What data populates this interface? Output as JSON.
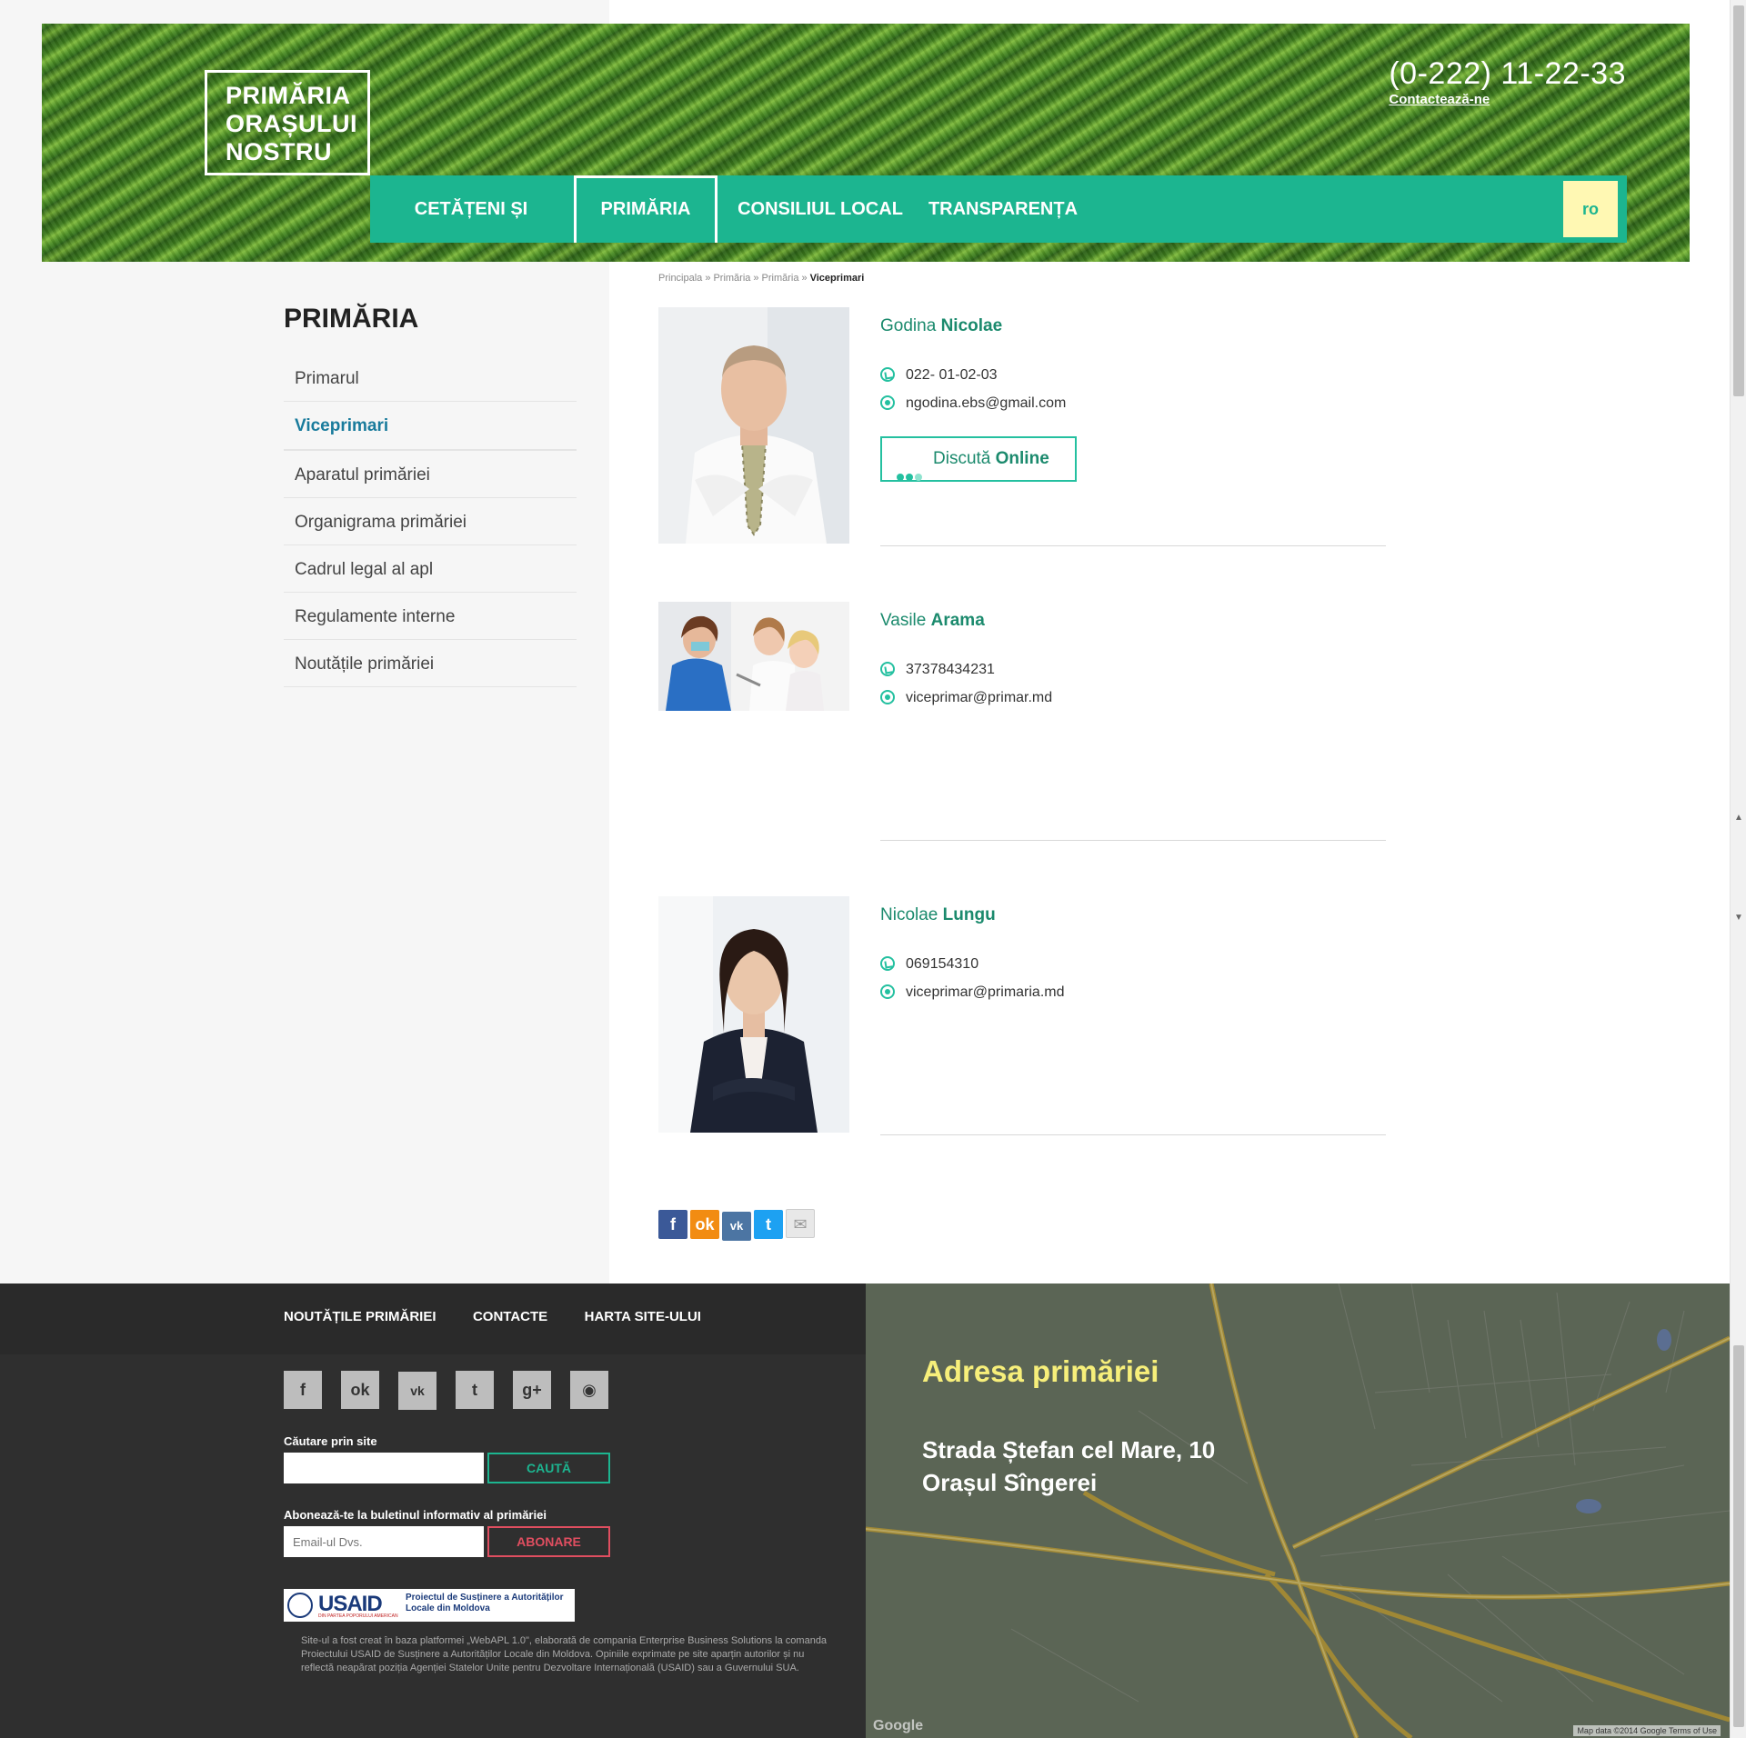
{
  "header": {
    "logo_line1": "PRIMĂRIA",
    "logo_line2": "ORAȘULUI",
    "logo_line3": "NOSTRU",
    "phone": "(0-222) 11-22-33",
    "contact_link": "Contactează-ne"
  },
  "nav": {
    "items": [
      {
        "label": "CETĂȚENI ȘI BUSINESS"
      },
      {
        "label": "PRIMĂRIA"
      },
      {
        "label": "CONSILIUL LOCAL"
      },
      {
        "label": "TRANSPARENȚA"
      }
    ],
    "active": "PRIMĂRIA",
    "lang": "ro"
  },
  "breadcrumb": {
    "items": [
      "Principala",
      "Primăria",
      "Primăria"
    ],
    "separator": "»",
    "current": "Viceprimari"
  },
  "sidebar": {
    "title": "PRIMĂRIA",
    "items": [
      {
        "label": "Primarul"
      },
      {
        "label": "Viceprimari"
      },
      {
        "label": "Aparatul primăriei"
      },
      {
        "label": "Organigrama primăriei"
      },
      {
        "label": "Cadrul legal al apl"
      },
      {
        "label": "Regulamente interne"
      },
      {
        "label": "Noutățile primăriei"
      }
    ],
    "active": "Viceprimari"
  },
  "people": [
    {
      "first": "Godina",
      "last": "Nicolae",
      "phone": "022- 01-02-03",
      "email": "ngodina.ebs@gmail.com",
      "chat_label_1": "Discută",
      "chat_label_2": "Online"
    },
    {
      "first": "Vasile",
      "last": "Arama",
      "phone": "37378434231",
      "email": "viceprimar@primar.md"
    },
    {
      "first": "Nicolae",
      "last": "Lungu",
      "phone": "069154310",
      "email": "viceprimar@primaria.md"
    }
  ],
  "share": {
    "icons": [
      "facebook-icon",
      "odnoklassniki-icon",
      "vk-icon",
      "twitter-icon",
      "email-icon"
    ]
  },
  "footer": {
    "nav": [
      "NOUTĂȚILE PRIMĂRIEI",
      "CONTACTE",
      "HARTA SITE-ULUI"
    ],
    "social": [
      "facebook-icon",
      "odnoklassniki-icon",
      "vk-icon",
      "twitter-icon",
      "google-plus-icon",
      "rss-icon"
    ],
    "search_label": "Căutare prin site",
    "search_button": "CAUTĂ",
    "subscribe_label": "Abonează-te la buletinul informativ al primăriei",
    "email_placeholder": "Email-ul Dvs.",
    "subscribe_button": "ABONARE",
    "usaid_brand": "USAID",
    "usaid_sub": "DIN PARTEA POPORULUI AMERICAN",
    "usaid_project": "Proiectul de Susținere a Autorităților Locale din Moldova",
    "disclaimer": "Site-ul a fost creat în baza platformei „WebAPL 1.0\", elaborată de compania Enterprise Business Solutions la comanda Proiectului USAID de Susținere a Autorităților Locale din Moldova. Opiniile exprimate pe site aparțin autorilor și nu reflectă neapărat poziția Agenției Statelor Unite pentru Dezvoltare Internațională (USAID) sau a Guvernului SUA."
  },
  "map": {
    "title": "Adresa primăriei",
    "address_line1": "Strada Ștefan cel Mare, 10",
    "address_line2": "Orașul Sîngerei",
    "attribution": "Map data ©2014 Google   Terms of Use",
    "google": "Google"
  },
  "colors": {
    "accent": "#1cb590",
    "link": "#197b9c",
    "name_green": "#1b8a6d",
    "lang_bg": "#fff8b3",
    "map_title": "#f7ef7a",
    "subscribe_red": "#e04e60"
  }
}
